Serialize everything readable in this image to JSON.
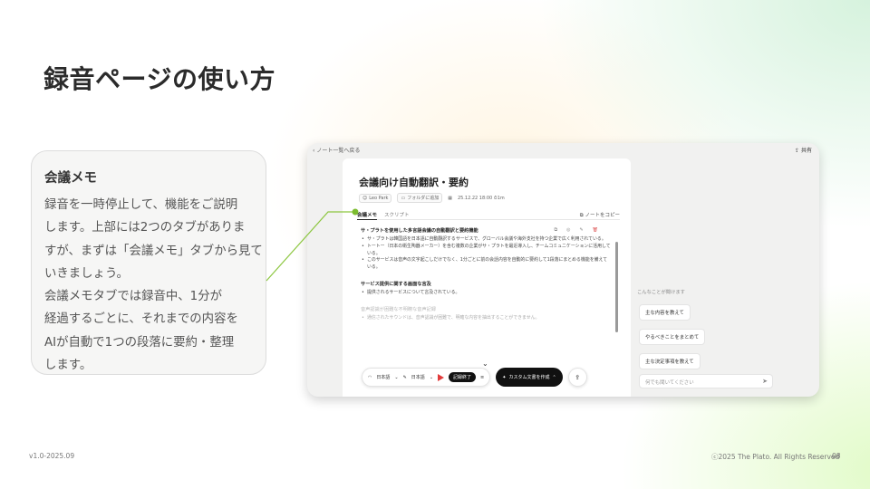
{
  "slide": {
    "title": "録音ページの使い方",
    "note_heading": "会議メモ",
    "note_lines": [
      "録音を一時停止して、機能をご説明",
      "します。上部には2つのタブがありま",
      "すが、まずは「会議メモ」タブから見て",
      "いきましょう。",
      "会議メモタブでは録音中、1分が",
      "経過するごとに、それまでの内容を",
      "AIが自動で1つの段落に要約・整理",
      "します。"
    ],
    "version": "v1.0-2025.09",
    "copyright": "ⓒ2025 The Plato. All Rights Reserved",
    "page_number": "08"
  },
  "app": {
    "back_link": "ノート一覧へ戻る",
    "share_label": "共有",
    "doc_title": "会議向け自動翻訳・要約",
    "meta": {
      "owner": "Leo Park",
      "folder": "フォルダに追加",
      "datetime": "25.12.22 18:00 ⏱1m"
    },
    "tabs": {
      "memo": "会議メモ",
      "script": "スクリプト"
    },
    "copy_note": "ノートをコピー",
    "memo_sections": [
      {
        "title": "サ・プラトを使用した多言語会議の自動翻訳と要約機能",
        "bullets": [
          "サ・プラトは韓国語を日本語に自動翻訳するサービスで、グローバル会議や海外支社を持つ企業で広く利用されている。",
          "トートー（日本の衛生陶器メーカー）を含む複数の企業がサ・プラトを最近導入し、チームコミュニケーションに活用している。",
          "このサービスは音声の文字起こしだけでなく、1分ごとに前の会話内容を自動的に要約して1段落にまとめる機能を備えている。"
        ]
      },
      {
        "title": "サービス提供に関する画面な言及",
        "bullets": [
          "提供されるサービスについて言及されている。"
        ]
      },
      {
        "title": "音声認識が困難な不明瞭な音声記録",
        "bullets": [
          "通信されたサウンドは、音声認識が困難で、明確な内容を抽出することができません。"
        ]
      }
    ],
    "controls": {
      "lang_from": "日本語",
      "lang_to": "日本語",
      "end_record": "記録終了",
      "custom_doc": "カスタム文書を作成"
    },
    "chat": {
      "hint": "こんなことが聞けます",
      "suggestions": [
        "主な内容を教えて",
        "やるべきことをまとめて",
        "主な決定事項を教えて"
      ],
      "input_placeholder": "何でも聞いてください"
    }
  }
}
